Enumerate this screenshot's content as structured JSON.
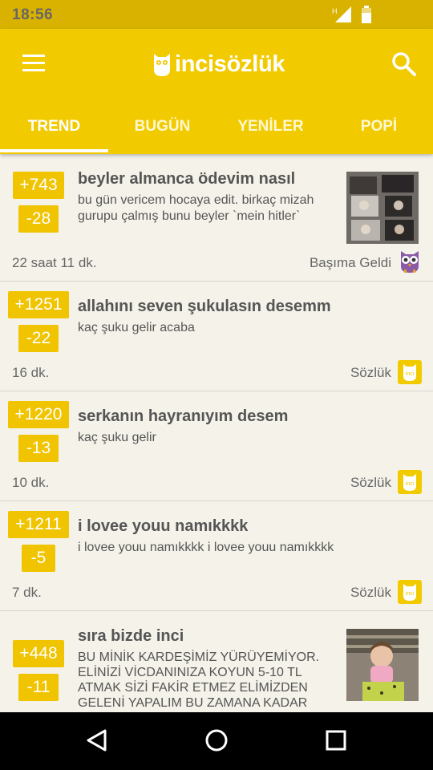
{
  "status": {
    "time": "18:56",
    "network": "H"
  },
  "app": {
    "logo_text": "incisözlük"
  },
  "tabs": [
    "TREND",
    "BUGÜN",
    "YENİLER",
    "POPİ"
  ],
  "entries": [
    {
      "up": "+743",
      "down": "-28",
      "title": "beyler almanca ödevim nasıl",
      "excerpt": [
        "bu gün vericem hocaya edit. birkaç mizah",
        "gurupu çalmış bunu beyler `mein hitler`"
      ],
      "time": "22 saat 11 dk.",
      "category": "Başıma Geldi",
      "category_icon": "owl-purple-icon",
      "has_thumb": true
    },
    {
      "up": "+1251",
      "down": "-22",
      "title": "allahını seven şukulasın desemm",
      "excerpt": [
        "kaç şuku gelir acaba"
      ],
      "time": "16 dk.",
      "category": "Sözlük",
      "category_icon": "inci-logo-icon",
      "has_thumb": false
    },
    {
      "up": "+1220",
      "down": "-13",
      "title": "serkanın hayranıyım desem",
      "excerpt": [
        "kaç şuku gelir"
      ],
      "time": "10 dk.",
      "category": "Sözlük",
      "category_icon": "inci-logo-icon",
      "has_thumb": false
    },
    {
      "up": "+1211",
      "down": "-5",
      "title": "i lovee youu namıkkkk",
      "excerpt": [
        "i lovee youu namıkkkk i lovee youu namıkkkk"
      ],
      "time": "7 dk.",
      "category": "Sözlük",
      "category_icon": "inci-logo-icon",
      "has_thumb": false
    },
    {
      "up": "+448",
      "down": "-11",
      "title": "sıra bizde inci",
      "excerpt": [
        "BU MİNİK KARDEŞİMİZ YÜRÜYEMİYOR.",
        "ELİNİZİ VİCDANINIZA KOYUN 5-10 TL",
        "ATMAK SİZİ FAKİR ETMEZ ELİMİZDEN",
        "GELENİ YAPALIM BU ZAMANA KADAR"
      ],
      "time": "",
      "category": "",
      "category_icon": "",
      "has_thumb": true
    }
  ]
}
